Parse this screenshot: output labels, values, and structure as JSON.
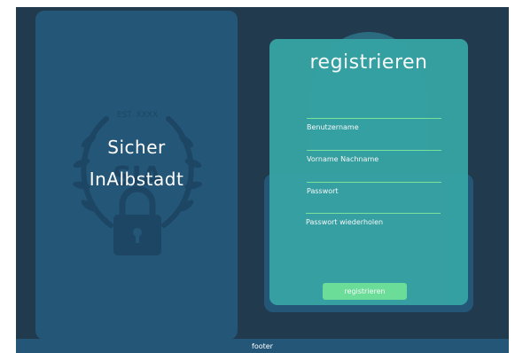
{
  "brand": {
    "line1": "Sicher",
    "line2": "InAlbstadt",
    "emblem_text": "EST. XXXX",
    "emblem_letters": "SIA"
  },
  "form": {
    "title": "registrieren",
    "fields": [
      {
        "label": "Benutzername",
        "value": ""
      },
      {
        "label": "Vorname Nachname",
        "value": ""
      },
      {
        "label": "Passwort",
        "value": ""
      },
      {
        "label": "Passwort wiederholen",
        "value": ""
      }
    ],
    "submit_label": "registrieren"
  },
  "footer": {
    "text": "footer"
  },
  "colors": {
    "background": "#213a4d",
    "panel": "#245677",
    "card": "#36a3a3",
    "accent": "#6fe39a"
  },
  "icons": [
    "laurel-wreath-icon",
    "padlock-icon"
  ]
}
